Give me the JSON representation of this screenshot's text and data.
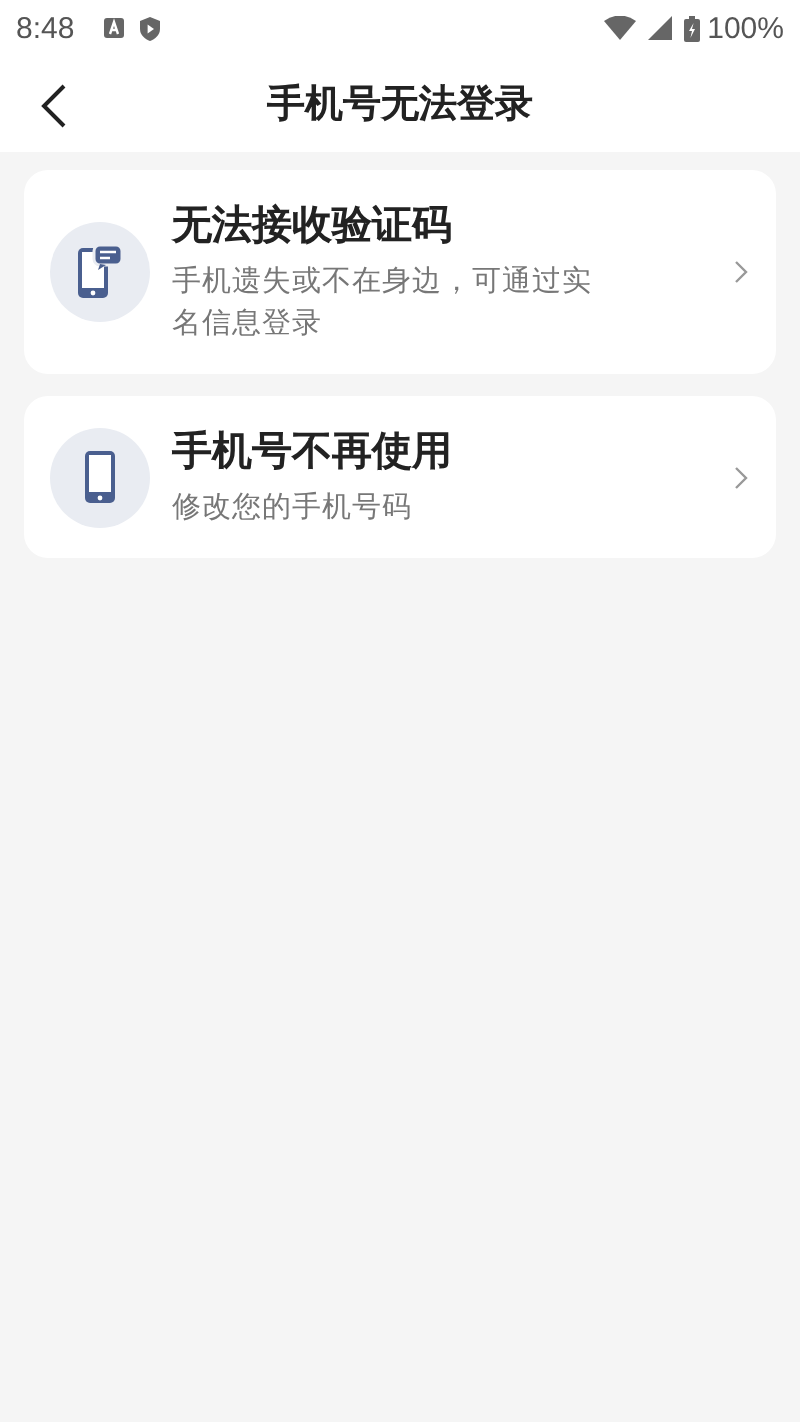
{
  "status_bar": {
    "time": "8:48",
    "battery": "100%"
  },
  "header": {
    "title": "手机号无法登录"
  },
  "options": [
    {
      "kind": "sms",
      "title": "无法接收验证码",
      "subtitle": "手机遗失或不在身边，可通过实名信息登录"
    },
    {
      "kind": "phone",
      "title": "手机号不再使用",
      "subtitle": "修改您的手机号码"
    }
  ]
}
